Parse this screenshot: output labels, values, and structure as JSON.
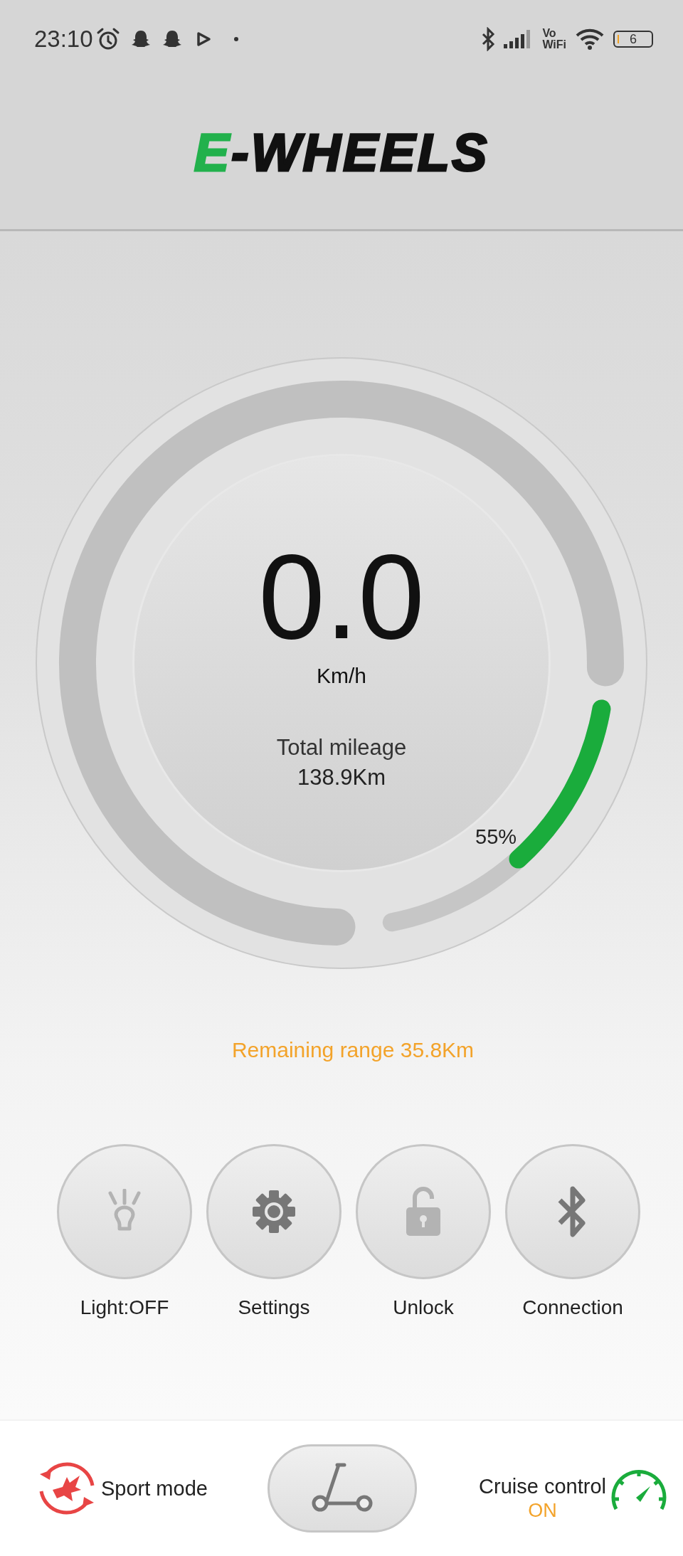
{
  "status_bar": {
    "time": "23:10",
    "vowifi": [
      "Vo",
      "WiFi"
    ],
    "battery": "6"
  },
  "header": {
    "logo_mark": "E",
    "logo_text": "-WHEELS"
  },
  "gauge": {
    "speed": "0.0",
    "unit": "Km/h",
    "mileage_label": "Total mileage",
    "mileage_value": "138.9Km",
    "battery": {
      "reading": "55%"
    }
  },
  "remaining_range": "Remaining range 35.8Km",
  "controls": [
    {
      "kind": "light",
      "label": "Light:OFF",
      "enabled": false
    },
    {
      "kind": "settings",
      "label": "Settings",
      "enabled": true
    },
    {
      "kind": "unlock",
      "label": "Unlock",
      "enabled": false
    },
    {
      "kind": "connection",
      "label": "Connection",
      "enabled": true
    }
  ],
  "bottom_bar": {
    "sport_mode": {
      "label": "Sport mode"
    },
    "cruise_control": {
      "label": "Cruise control",
      "status": "ON"
    }
  }
}
